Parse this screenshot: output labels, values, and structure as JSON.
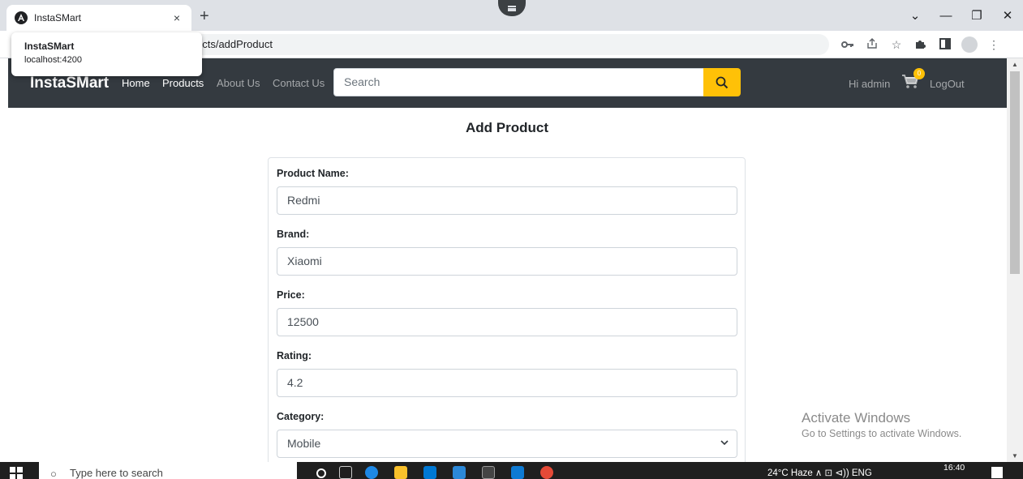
{
  "browser": {
    "tab_title": "InstaSMart",
    "tab_close": "×",
    "new_tab": "+",
    "url_visible": "ucts/addProduct",
    "hover_card": {
      "title": "InstaSMart",
      "url": "localhost:4200"
    },
    "window_controls": [
      "⌄",
      "—",
      "❐",
      "✕"
    ]
  },
  "navbar": {
    "brand": "InstaSMart",
    "links": [
      "Home",
      "Products",
      "About Us",
      "Contact Us"
    ],
    "search_placeholder": "Search",
    "greeting": "Hi admin",
    "cart_count": "0",
    "logout": "LogOut",
    "accent_color": "#ffc107",
    "bg_color": "#343a40"
  },
  "page": {
    "heading": "Add Product",
    "fields": [
      {
        "label": "Product Name:",
        "value": "Redmi"
      },
      {
        "label": "Brand:",
        "value": "Xiaomi"
      },
      {
        "label": "Price:",
        "value": "12500"
      },
      {
        "label": "Rating:",
        "value": "4.2"
      },
      {
        "label": "Category:",
        "value": "Mobile"
      }
    ]
  },
  "watermark": {
    "title": "Activate Windows",
    "subtitle": "Go to Settings to activate Windows."
  },
  "taskbar": {
    "search_placeholder": "Type here to search",
    "tray_text": "24°C  Haze  ∧  ⊡  ⊲))  ENG",
    "time": "16:40"
  }
}
